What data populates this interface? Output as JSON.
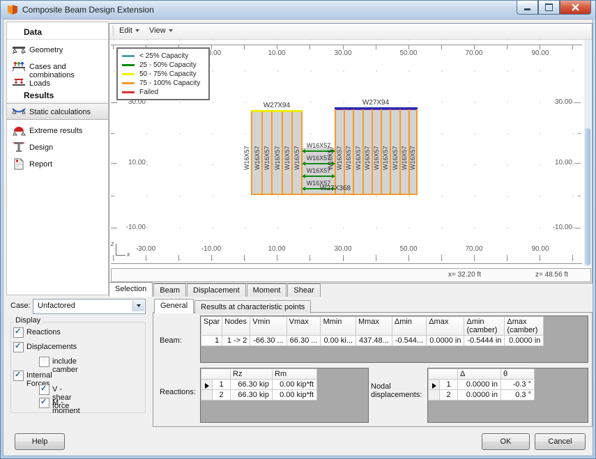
{
  "window": {
    "title": "Composite Beam Design Extension"
  },
  "sidebar": {
    "sections": [
      {
        "header": "Data",
        "items": [
          {
            "label": "Geometry"
          },
          {
            "label": "Cases and combinations"
          },
          {
            "label": "Loads"
          }
        ]
      },
      {
        "header": "Results",
        "items": [
          {
            "label": "Static calculations",
            "selected": true
          },
          {
            "label": "Extreme results"
          },
          {
            "label": "Design"
          },
          {
            "label": "Report"
          }
        ]
      }
    ]
  },
  "toolbar": {
    "menus": [
      "Edit",
      "View"
    ]
  },
  "legend": {
    "items": [
      {
        "label": "< 25% Capacity",
        "color": "#4e9fa2"
      },
      {
        "label": "25 - 50% Capacity",
        "color": "#0a8a0a"
      },
      {
        "label": "50 - 75% Capacity",
        "color": "#f0f00a"
      },
      {
        "label": "75 - 100% Capacity",
        "color": "#f79a28"
      },
      {
        "label": "Failed",
        "color": "#e03030"
      }
    ]
  },
  "viewport": {
    "top_axis_labels": [
      "-10.00",
      "10.00",
      "30.00",
      "50.00",
      "70.00",
      "90.00"
    ],
    "bottom_axis_labels": [
      "-30.00",
      "-10.00",
      "10.00",
      "30.00",
      "50.00",
      "70.00",
      "90.00"
    ],
    "left_axis_labels": [
      "30.00",
      "10.00",
      "-10.00"
    ],
    "right_axis_labels": [
      "30.00",
      "10.00",
      "-10.00"
    ],
    "axis_triad": {
      "vertical": "z",
      "horizontal": "x"
    },
    "status": {
      "x": "x= 32.20 ft",
      "z": "z= 48.56 ft"
    },
    "model": {
      "girder_top_left": "W27X94",
      "girder_top_right": "W27X94",
      "girder_bottom": "W27X368",
      "infill_beam": "W16X57"
    }
  },
  "view_tabs": [
    {
      "label": "Selection"
    },
    {
      "label": "Beam"
    },
    {
      "label": "Displacement"
    },
    {
      "label": "Moment"
    },
    {
      "label": "Shear"
    }
  ],
  "case_selector": {
    "label": "Case:",
    "value": "Unfactored"
  },
  "display_panel": {
    "title": "Display",
    "options": [
      {
        "label": "Reactions",
        "checked": true
      },
      {
        "label": "Displacements",
        "checked": true
      },
      {
        "label": "include camber",
        "checked": false
      },
      {
        "label": "Internal Forces",
        "checked": true
      },
      {
        "label": "V - shear force",
        "checked": true
      },
      {
        "label": "M - moment",
        "checked": true
      }
    ]
  },
  "results_tabs": [
    {
      "label": "General"
    },
    {
      "label": "Results at characteristic points"
    }
  ],
  "beam_table": {
    "label": "Beam:",
    "headers": [
      "Spar",
      "Nodes",
      "Vmin",
      "Vmax",
      "Mmin",
      "Mmax",
      "Δmin",
      "Δmax",
      "Δmin (camber)",
      "Δmax (camber)"
    ],
    "rows": [
      [
        "1",
        "1 -> 2",
        "-66.30 ...",
        "66.30 ...",
        "0.00 ki...",
        "437.48...",
        "-0.544...",
        "0.0000 in",
        "-0.5444 in",
        "0.0000 in"
      ]
    ]
  },
  "reactions_table": {
    "label": "Reactions:",
    "headers": [
      "Rz",
      "Rm"
    ],
    "rows": [
      [
        "1",
        "66.30 kip",
        "0.00 kip*ft"
      ],
      [
        "2",
        "66.30 kip",
        "0.00 kip*ft"
      ]
    ]
  },
  "nodal_table": {
    "label": "Nodal displacements:",
    "headers": [
      "Δ",
      "θ"
    ],
    "rows": [
      [
        "1",
        "0.0000 in",
        "-0.3 °"
      ],
      [
        "2",
        "0.0000 in",
        "0.3 °"
      ]
    ]
  },
  "footer": {
    "help": "Help",
    "ok": "OK",
    "cancel": "Cancel"
  }
}
